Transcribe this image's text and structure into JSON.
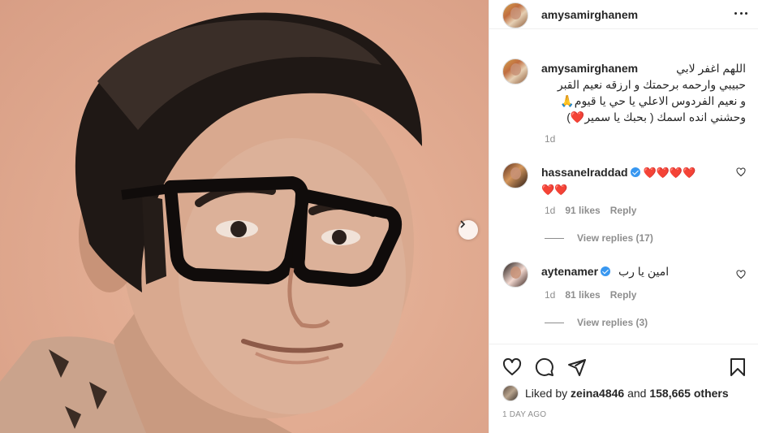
{
  "photo": {
    "alt_icons": {
      "next": "chevron-right-icon"
    }
  },
  "header": {
    "username": "amysamirghanem",
    "more_icon": "more-horizontal-icon"
  },
  "caption": {
    "username": "amysamirghanem",
    "line1": "اللهم اغفر لابي",
    "line2": "حبيبي وارحمه برحمتك و ارزقه نعيم القبر",
    "line3": "و نعيم الفردوس الاعلي يا حي يا قيوم🙏",
    "line4": "وحشني انده اسمك ( بحبك يا سمير❤️)",
    "time": "1d"
  },
  "comments": [
    {
      "username": "hassanelraddad",
      "verified": true,
      "text_line1": "❤️❤️❤️❤️",
      "text_line2": "❤️❤️",
      "time": "1d",
      "likes": "91 likes",
      "reply": "Reply",
      "view_replies": "View replies (17)"
    },
    {
      "username": "aytenamer",
      "verified": true,
      "text": "امين يا رب",
      "time": "1d",
      "likes": "81 likes",
      "reply": "Reply",
      "view_replies": "View replies (3)"
    }
  ],
  "actions": {
    "icons": [
      "heart-icon",
      "comment-icon",
      "share-icon",
      "bookmark-icon"
    ],
    "liked_by_prefix": "Liked by",
    "liked_by_user": "zeina4846",
    "liked_by_and": "and",
    "liked_by_others": "158,665 others",
    "date": "1 DAY AGO"
  },
  "colors": {
    "text": "#262626",
    "muted": "#8e8e8e",
    "verified": "#3897f0",
    "heart": "#e0245e",
    "photo_bg": "#e2ac92"
  }
}
